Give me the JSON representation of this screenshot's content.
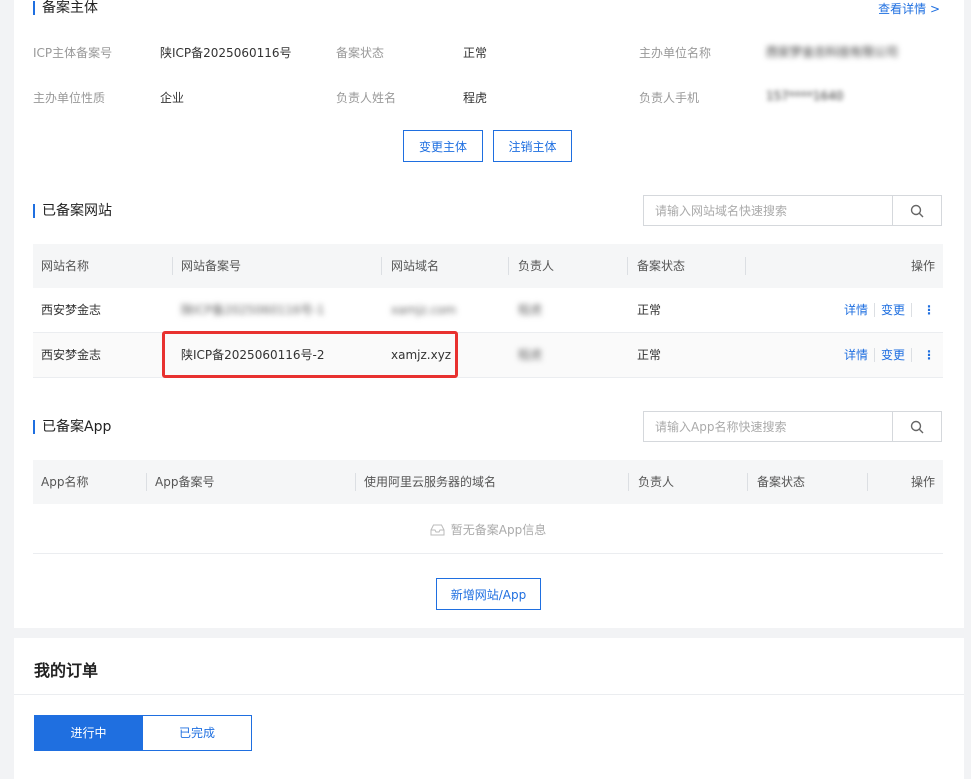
{
  "entity": {
    "title": "备案主体",
    "detail_link": "查看详情 >",
    "fields": [
      {
        "label": "ICP主体备案号",
        "value": "陕ICP备2025060116号"
      },
      {
        "label": "备案状态",
        "value": "正常"
      },
      {
        "label": "主办单位名称",
        "value": "西安梦金志科技有限公司"
      },
      {
        "label": "主办单位性质",
        "value": "企业"
      },
      {
        "label": "负责人姓名",
        "value": "程虎"
      },
      {
        "label": "负责人手机",
        "value": "157****1640"
      }
    ],
    "change_button": "变更主体",
    "cancel_button": "注销主体"
  },
  "websites": {
    "title": "已备案网站",
    "search_placeholder": "请输入网站域名快速搜索",
    "columns": [
      "网站名称",
      "网站备案号",
      "网站域名",
      "负责人",
      "备案状态",
      "操作"
    ],
    "rows": [
      {
        "name": "西安梦金志",
        "icp": "陕ICP备2025060116号-1",
        "domain": "xamjz.com",
        "owner": "程虎",
        "status": "正常",
        "detail": "详情",
        "change": "变更",
        "more": "⋮"
      },
      {
        "name": "西安梦金志",
        "icp": "陕ICP备2025060116号-2",
        "domain": "xamjz.xyz",
        "owner": "程虎",
        "status": "正常",
        "detail": "详情",
        "change": "变更",
        "more": "⋮"
      }
    ]
  },
  "apps": {
    "title": "已备案App",
    "search_placeholder": "请输入App名称快速搜索",
    "columns": [
      "App名称",
      "App备案号",
      "使用阿里云服务器的域名",
      "负责人",
      "备案状态",
      "操作"
    ],
    "empty_text": "暂无备案App信息"
  },
  "add_button": "新增网站/App",
  "orders": {
    "title": "我的订单",
    "tabs": [
      "进行中",
      "已完成"
    ]
  },
  "colors": {
    "accent": "#1f6fe0",
    "highlight": "#e8312f"
  }
}
